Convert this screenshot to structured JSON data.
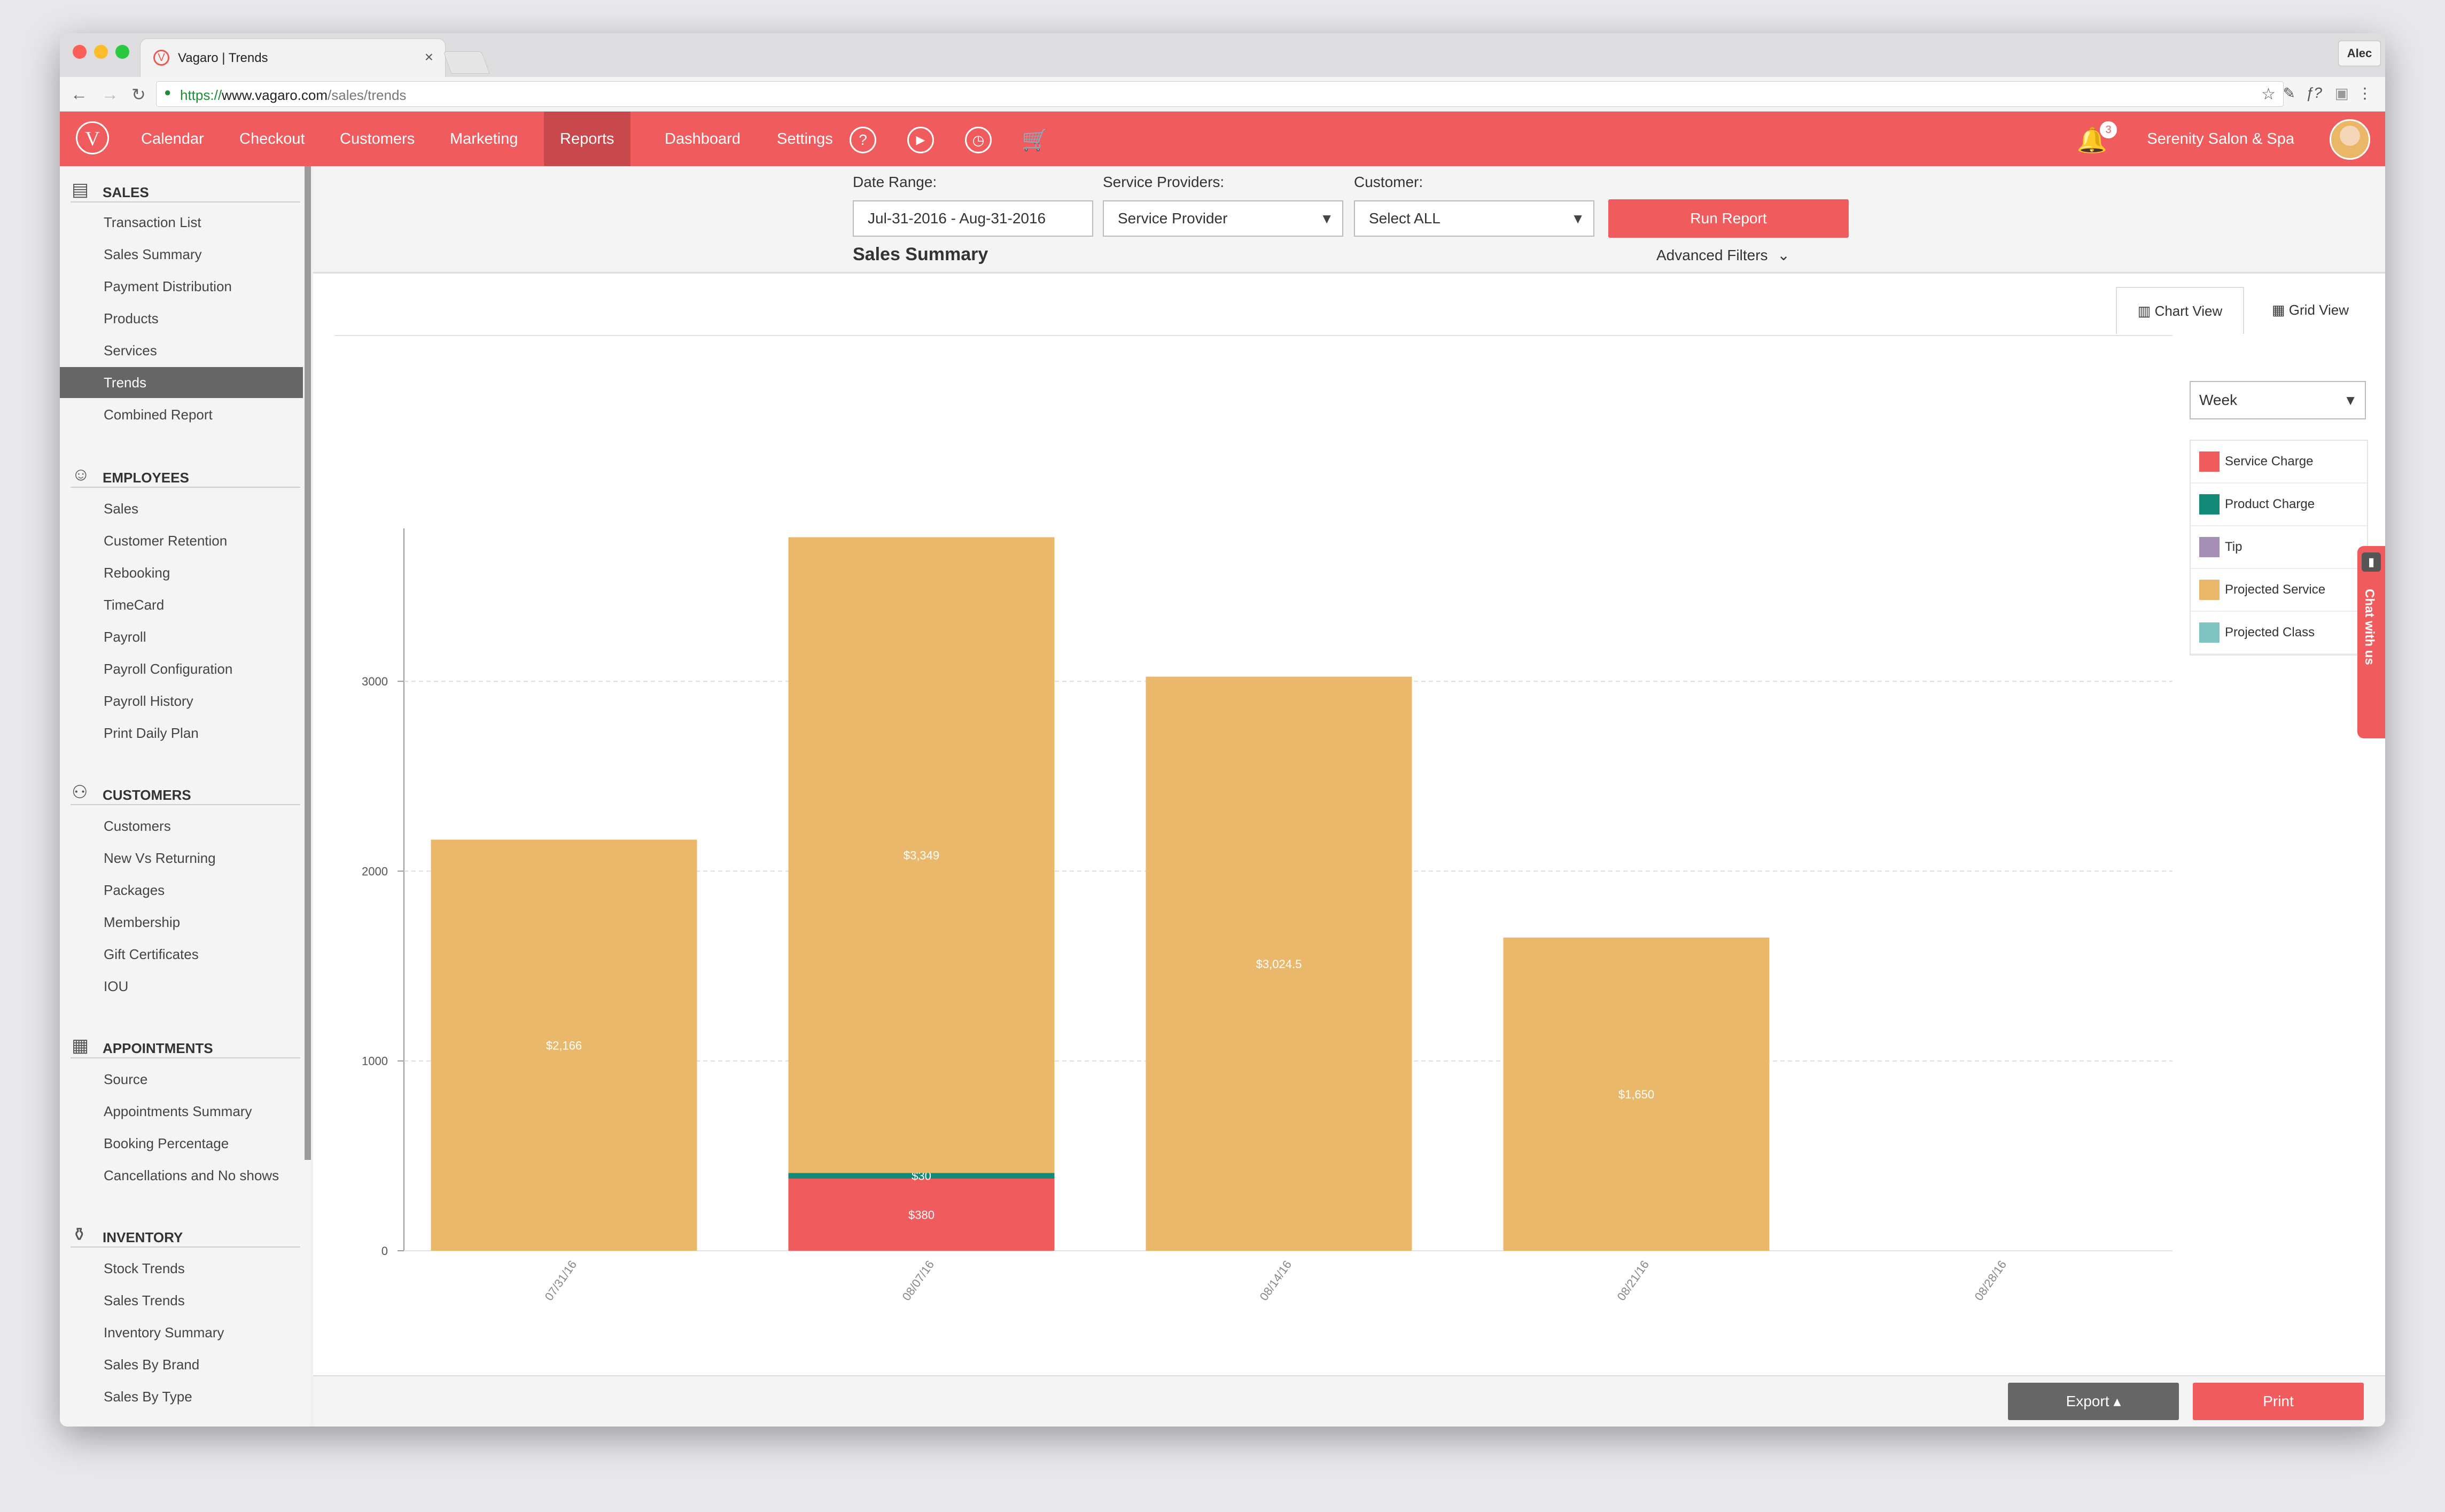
{
  "browser": {
    "tab_title": "Vagaro | Trends",
    "tab_close": "×",
    "user": "Alec",
    "url_prefix": "https://",
    "url": "www.vagaro.com",
    "url_path": "/sales/trends"
  },
  "nav": {
    "logo": "V",
    "items": [
      "Calendar",
      "Checkout",
      "Customers",
      "Marketing",
      "Reports",
      "Dashboard",
      "Settings"
    ],
    "active": "Reports",
    "help_icon": "?",
    "notifications": "3",
    "business": "Serenity Salon & Spa"
  },
  "sidebar": {
    "sections": [
      {
        "title": "SALES",
        "icon": "register-icon",
        "items": [
          "Transaction List",
          "Sales Summary",
          "Payment Distribution",
          "Products",
          "Services",
          "Trends",
          "Combined Report"
        ]
      },
      {
        "title": "EMPLOYEES",
        "icon": "person-icon",
        "items": [
          "Sales",
          "Customer Retention",
          "Rebooking",
          "TimeCard",
          "Payroll",
          "Payroll Configuration",
          "Payroll History",
          "Print Daily Plan"
        ]
      },
      {
        "title": "CUSTOMERS",
        "icon": "group-icon",
        "items": [
          "Customers",
          "New Vs Returning",
          "Packages",
          "Membership",
          "Gift Certificates",
          "IOU"
        ]
      },
      {
        "title": "APPOINTMENTS",
        "icon": "calendar-icon",
        "items": [
          "Source",
          "Appointments Summary",
          "Booking Percentage",
          "Cancellations and No shows"
        ]
      },
      {
        "title": "INVENTORY",
        "icon": "bottles-icon",
        "items": [
          "Stock Trends",
          "Sales Trends",
          "Inventory Summary",
          "Sales By Brand",
          "Sales By Type"
        ]
      }
    ],
    "active_item": "Trends"
  },
  "filters": {
    "date_label": "Date Range:",
    "date_value": "Jul-31-2016 - Aug-31-2016",
    "provider_label": "Service Providers:",
    "provider_value": "Service Provider",
    "customer_label": "Customer:",
    "customer_value": "Select ALL",
    "run_button": "Run Report",
    "advanced": "Advanced Filters",
    "dropdown_caret": "▼",
    "chevron": "⌄"
  },
  "page_title": "Sales Summary",
  "views": {
    "chart": "Chart View",
    "grid": "Grid View",
    "active": "Chart View"
  },
  "period": "Week",
  "chat_widget": "Chat with us",
  "footer": {
    "export": "Export ▴",
    "print": "Print"
  },
  "chart_data": {
    "type": "bar",
    "stacked": true,
    "categories": [
      "07/31/16",
      "08/07/16",
      "08/14/16",
      "08/21/16",
      "08/28/16"
    ],
    "ylim": [
      0,
      3800
    ],
    "yticks": [
      0,
      1000,
      2000,
      3000
    ],
    "grid": true,
    "legend_position": "right",
    "series": [
      {
        "name": "Service Charge",
        "color": "#f05b5d",
        "values": [
          0,
          380,
          0,
          0,
          0
        ],
        "labels": [
          "",
          "$380",
          "",
          "",
          ""
        ]
      },
      {
        "name": "Product Charge",
        "color": "#138a78",
        "values": [
          0,
          30,
          0,
          0,
          0
        ],
        "labels": [
          "",
          "$30",
          "",
          "",
          ""
        ]
      },
      {
        "name": "Tip",
        "color": "#a58fb4",
        "values": [
          0,
          0,
          0,
          0,
          0
        ],
        "labels": [
          "",
          "",
          "",
          "",
          ""
        ]
      },
      {
        "name": "Projected Service",
        "color": "#e9b86b",
        "values": [
          2166,
          3349,
          3024.5,
          1650,
          0
        ],
        "labels": [
          "$2,166",
          "$3,349",
          "$3,024.5",
          "$1,650",
          ""
        ]
      },
      {
        "name": "Projected Class",
        "color": "#80c4c2",
        "values": [
          0,
          0,
          0,
          0,
          0
        ],
        "labels": [
          "",
          "",
          "",
          "",
          ""
        ]
      }
    ]
  }
}
